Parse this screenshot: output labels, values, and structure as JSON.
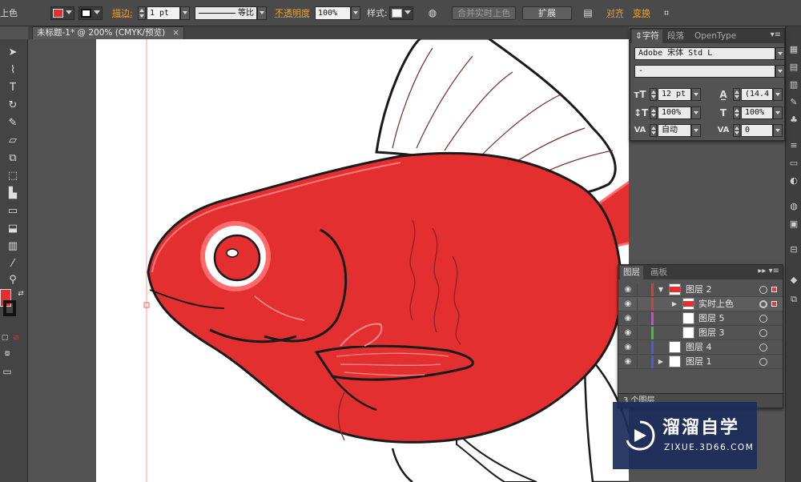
{
  "control_bar": {
    "selection_label": "上色",
    "fill_color": "#e32f30",
    "stroke_label": "描边:",
    "stroke_weight": "1 pt",
    "stroke_profile": "等比",
    "opacity_label": "不透明度",
    "opacity_value": "100%",
    "style_label": "样式:",
    "merge_button": "合并实时上色",
    "expand_button": "扩展",
    "align_label": "对齐",
    "transform_label": "变换"
  },
  "document_tab": {
    "title": "未标题-1* @ 200% (CMYK/预览)",
    "close": "×"
  },
  "character_panel": {
    "tabs": [
      "字符",
      "段落",
      "OpenType"
    ],
    "font_family": "Adobe 宋体 Std L",
    "font_style": "-",
    "font_size": "12 pt",
    "leading": "(14.4",
    "vertical_scale": "100%",
    "horizontal_scale": "100%",
    "kerning": "自动",
    "tracking": "0"
  },
  "layers_panel": {
    "tabs": [
      "图层",
      "画板"
    ],
    "rows": [
      {
        "name": "图层 2",
        "color": "#e03a3a"
      },
      {
        "name": "实时上色",
        "color": "#e03a3a"
      },
      {
        "name": "图层 5",
        "color": "#c050d0"
      },
      {
        "name": "图层 3",
        "color": "#40c040"
      },
      {
        "name": "图层 4",
        "color": "#4a5ad8"
      },
      {
        "name": "图层 1",
        "color": "#4a5ad8"
      }
    ],
    "footer": "3 个图层"
  },
  "watermark": {
    "title": "溜溜自学",
    "url": "ZIXUE.3D66.COM"
  },
  "canvas": {
    "fish_fill": "#e32f30",
    "outline_color": "#ff6b6b"
  }
}
